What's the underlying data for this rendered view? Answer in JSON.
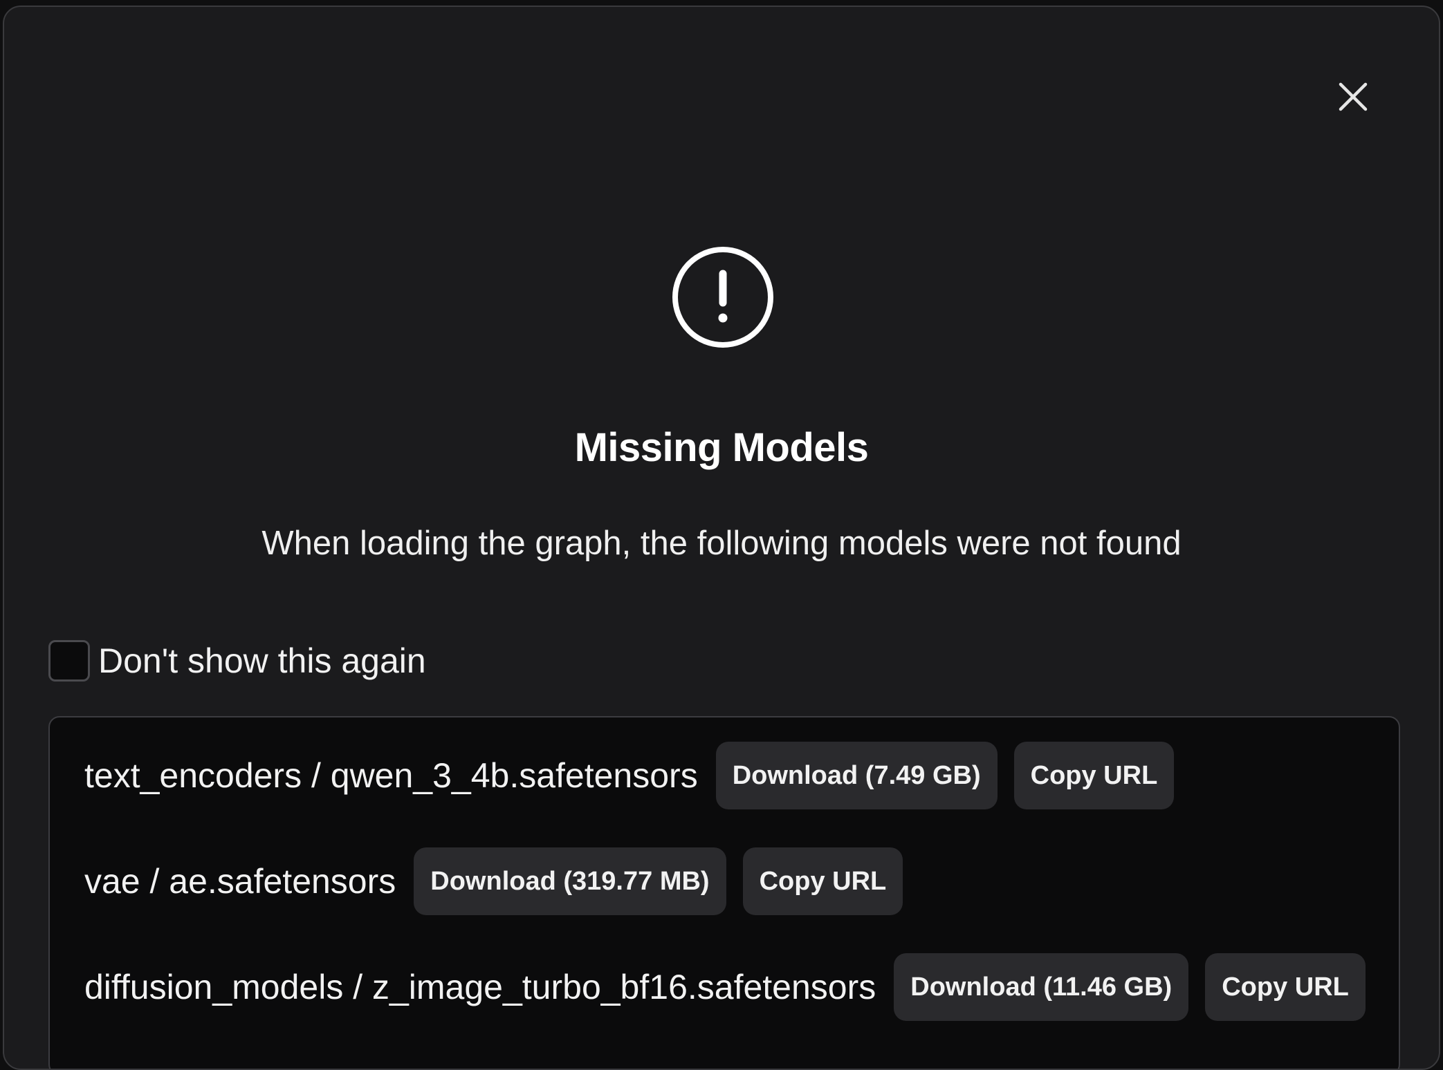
{
  "dialog": {
    "title": "Missing Models",
    "message": "When loading the graph, the following models were not found",
    "close_icon": "close-icon",
    "alert_icon": "exclamation-circle-icon"
  },
  "dont_show": {
    "label": "Don't show this again",
    "checked": false
  },
  "models": [
    {
      "name": "text_encoders / qwen_3_4b.safetensors",
      "download_label": "Download (7.49 GB)",
      "copy_label": "Copy URL"
    },
    {
      "name": "vae / ae.safetensors",
      "download_label": "Download (319.77 MB)",
      "copy_label": "Copy URL"
    },
    {
      "name": "diffusion_models / z_image_turbo_bf16.safetensors",
      "download_label": "Download (11.46 GB)",
      "copy_label": "Copy URL"
    }
  ],
  "colors": {
    "dialog_bg": "#1b1b1d",
    "list_bg": "#0b0b0c",
    "button_bg": "#2a2a2d",
    "text": "#f2f2f2"
  }
}
